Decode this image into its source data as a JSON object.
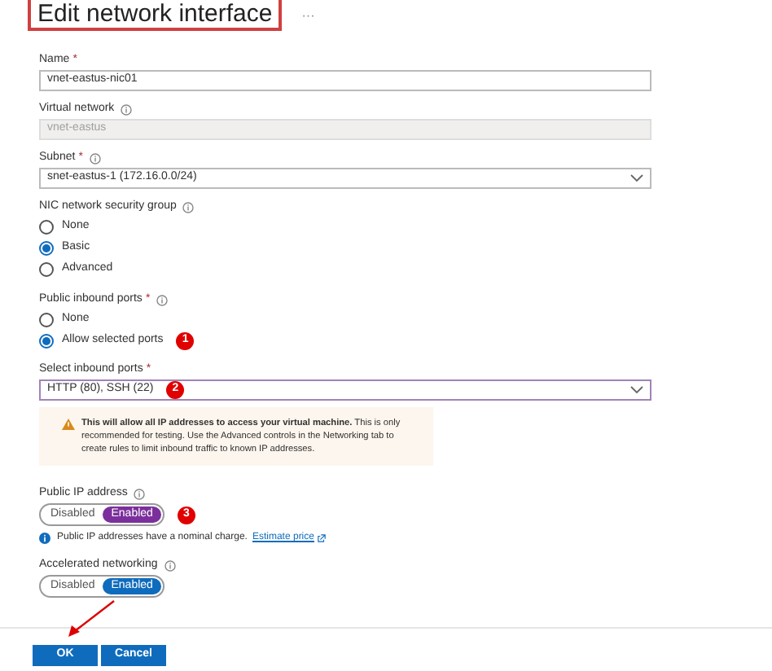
{
  "title": "Edit network interface",
  "more": "···",
  "fields": [
    {
      "kind": "text",
      "label": "Name",
      "required": "*",
      "value": "vnet-eastus-nic01",
      "disabled": false
    },
    {
      "kind": "text",
      "label": "Virtual network",
      "info": true,
      "value": "vnet-eastus",
      "disabled": true
    },
    {
      "kind": "select",
      "label": "Subnet",
      "required": "*",
      "info": true,
      "value": "snet-eastus-1 (172.16.0.0/24)",
      "disabled": false
    }
  ],
  "nsg": {
    "label": "NIC network security group",
    "info": true,
    "options": [
      {
        "label": "None",
        "selected": false
      },
      {
        "label": "Basic",
        "selected": true
      },
      {
        "label": "Advanced",
        "selected": false
      }
    ]
  },
  "inbound": {
    "label": "Public inbound ports",
    "required": "*",
    "info": true,
    "options": [
      {
        "label": "None",
        "selected": false
      },
      {
        "label": "Allow selected ports",
        "selected": true,
        "marker": "1"
      }
    ]
  },
  "ports": {
    "label": "Select inbound ports",
    "required": "*",
    "value": "HTTP (80), SSH (22)",
    "marker": "2"
  },
  "warning": "**This will allow all IP addresses to access your virtual machine.** This is only recommended for testing.  Use the Advanced controls in the Networking tab to create rules to limit inbound traffic to known IP addresses.",
  "toggles": [
    {
      "label": "Public IP address",
      "color": "#7b2f9c",
      "marker": "3",
      "options": [
        {
          "label": "Disabled",
          "selected": false
        },
        {
          "label": "Enabled",
          "selected": true
        }
      ]
    },
    {
      "label": "Accelerated networking",
      "color": "#0f6cbd",
      "options": [
        {
          "label": "Disabled",
          "selected": false
        },
        {
          "label": "Enabled",
          "selected": true
        }
      ]
    }
  ],
  "ip_note": {
    "text": "Public IP addresses have a nominal charge.",
    "link": "Estimate price"
  },
  "buttons": [
    "OK",
    "Cancel"
  ]
}
